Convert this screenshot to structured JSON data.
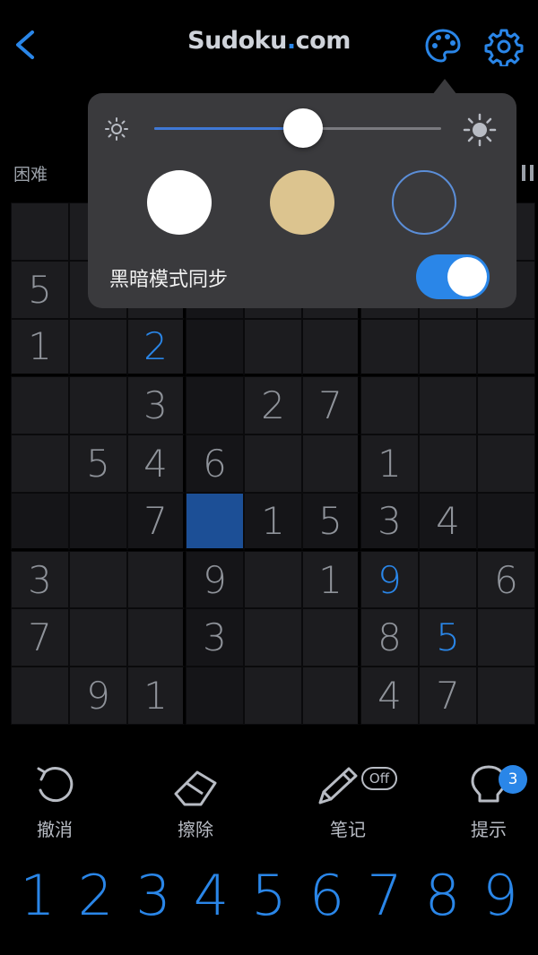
{
  "header": {
    "title_main": "Sudoku",
    "title_dot": ".",
    "title_tail": "com",
    "accent": "#2a86e8"
  },
  "info": {
    "difficulty": "困难"
  },
  "grid": {
    "cells": [
      [
        "",
        "",
        "",
        "",
        "",
        "",
        "",
        "",
        ""
      ],
      [
        "5",
        "",
        "",
        "",
        "",
        "",
        "",
        "",
        ""
      ],
      [
        "1",
        "",
        "2",
        "",
        "",
        "",
        "",
        "",
        ""
      ],
      [
        "",
        "",
        "3",
        "",
        "2",
        "7",
        "",
        "",
        ""
      ],
      [
        "",
        "5",
        "4",
        "6",
        "",
        "",
        "1",
        "",
        ""
      ],
      [
        "",
        "",
        "7",
        "",
        "1",
        "5",
        "3",
        "4",
        ""
      ],
      [
        "3",
        "",
        "",
        "9",
        "",
        "1",
        "9",
        "",
        "6"
      ],
      [
        "7",
        "",
        "",
        "3",
        "",
        "",
        "8",
        "5",
        ""
      ],
      [
        "",
        "9",
        "1",
        "",
        "",
        "",
        "4",
        "7",
        ""
      ]
    ],
    "user_entered": [
      [
        2,
        2
      ],
      [
        6,
        6
      ],
      [
        7,
        7
      ]
    ],
    "selected": [
      5,
      3
    ]
  },
  "popup": {
    "brightness": 0.52,
    "themes": [
      "white",
      "gold",
      "dark"
    ],
    "sync_label": "黑暗模式同步",
    "sync_on": true
  },
  "toolbar": {
    "undo_label": "撤消",
    "erase_label": "擦除",
    "notes_label": "笔记",
    "notes_state": "Off",
    "hint_label": "提示",
    "hint_count": "3"
  },
  "numpad": [
    "1",
    "2",
    "3",
    "4",
    "5",
    "6",
    "7",
    "8",
    "9"
  ]
}
